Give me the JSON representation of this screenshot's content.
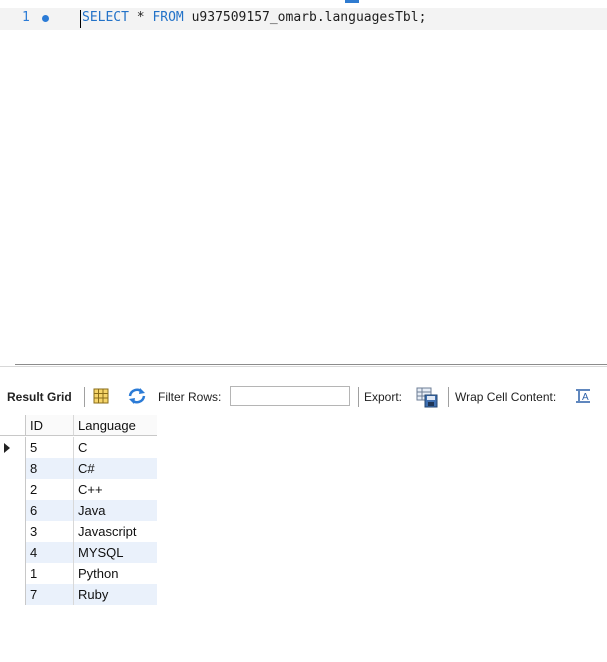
{
  "editor": {
    "line_number": "1",
    "code": {
      "kw_select": "SELECT",
      "star": " * ",
      "kw_from": "FROM",
      "rest": " u937509157_omarb.languagesTbl;"
    }
  },
  "toolbar": {
    "result_grid": "Result Grid",
    "filter_rows": "Filter Rows:",
    "filter_value": "",
    "export": "Export:",
    "wrap_cell": "Wrap Cell Content:"
  },
  "grid": {
    "columns": [
      "ID",
      "Language"
    ],
    "rows": [
      {
        "id": "5",
        "language": "C"
      },
      {
        "id": "8",
        "language": "C#"
      },
      {
        "id": "2",
        "language": "C++"
      },
      {
        "id": "6",
        "language": "Java"
      },
      {
        "id": "3",
        "language": "Javascript"
      },
      {
        "id": "4",
        "language": "MYSQL"
      },
      {
        "id": "1",
        "language": "Python"
      },
      {
        "id": "7",
        "language": "Ruby"
      }
    ]
  },
  "icons": {
    "grid_view": "grid-icon",
    "refresh": "refresh-icon",
    "export": "export-icon",
    "wrap": "wrap-icon"
  }
}
